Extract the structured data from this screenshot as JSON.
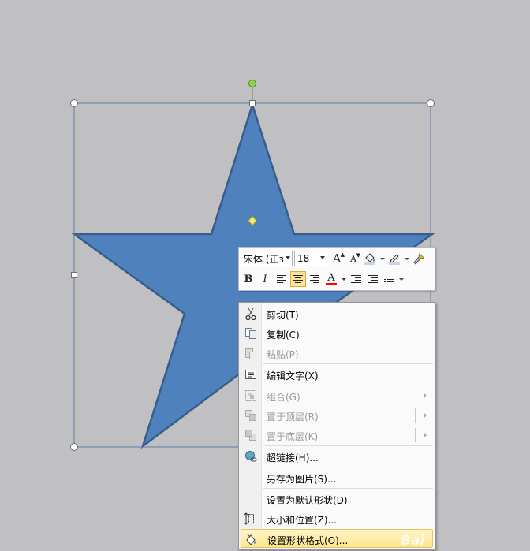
{
  "canvas": {
    "background": "#c0bfc2",
    "shape_fill": "#4f81bd",
    "shape_stroke": "#385d8a"
  },
  "shape": {
    "name": "five-point-star"
  },
  "mini_toolbar": {
    "font_name": "宋体 (正з",
    "font_size": "18",
    "row1_icons": [
      "grow-font-icon",
      "shrink-font-icon",
      "fill-color-icon",
      "line-color-icon",
      "format-painter-icon"
    ],
    "row2_icons": [
      "bold-icon",
      "italic-icon",
      "align-left-icon",
      "align-center-icon",
      "align-right-icon",
      "font-color-icon",
      "decrease-indent-icon",
      "increase-indent-icon",
      "bullets-icon"
    ],
    "bold_label": "B",
    "italic_label": "I",
    "grow_label": "A",
    "shrink_label": "A",
    "font_color_label": "A",
    "font_color": "#ff0000"
  },
  "context_menu": {
    "items": [
      {
        "label": "剪切(T)",
        "icon": "scissors-icon",
        "enabled": true
      },
      {
        "label": "复制(C)",
        "icon": "copy-icon",
        "enabled": true
      },
      {
        "label": "粘贴(P)",
        "icon": "paste-icon",
        "enabled": false
      },
      {
        "label": "编辑文字(X)",
        "icon": "edit-text-icon",
        "enabled": true
      },
      {
        "label": "组合(G)",
        "icon": "group-icon",
        "enabled": false,
        "submenu": true
      },
      {
        "label": "置于顶层(R)",
        "icon": "bring-to-front-icon",
        "enabled": false,
        "submenu": true
      },
      {
        "label": "置于底层(K)",
        "icon": "send-to-back-icon",
        "enabled": false,
        "submenu": true
      },
      {
        "label": "超链接(H)...",
        "icon": "hyperlink-icon",
        "enabled": true
      },
      {
        "label": "另存为图片(S)...",
        "icon": "",
        "enabled": true
      },
      {
        "label": "设置为默认形状(D)",
        "icon": "",
        "enabled": true
      },
      {
        "label": "大小和位置(Z)...",
        "icon": "size-position-icon",
        "enabled": true
      },
      {
        "label": "设置形状格式(O)...",
        "icon": "format-shape-icon",
        "enabled": true,
        "highlighted": true
      }
    ]
  },
  "watermark": "Bai"
}
